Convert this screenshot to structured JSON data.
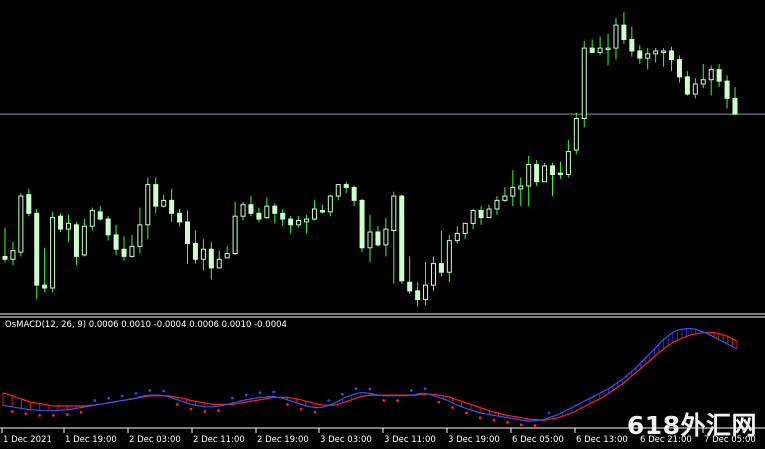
{
  "indicator": {
    "name": "OsMACD(12, 26, 9)",
    "values": [
      "0.0006",
      "0.0010",
      "-0.0004",
      "0.0006",
      "0.0010",
      "-0.0004"
    ]
  },
  "time_axis": {
    "labels": [
      "1 Dec 2021",
      "1 Dec 19:00",
      "2 Dec 03:00",
      "2 Dec 11:00",
      "2 Dec 19:00",
      "3 Dec 03:00",
      "3 Dec 11:00",
      "3 Dec 19:00",
      "6 Dec 05:00",
      "6 Dec 13:00",
      "6 Dec 21:00",
      "7 Dec 05:00"
    ]
  },
  "watermark": {
    "text": "618外汇网"
  },
  "colors": {
    "background": "#000000",
    "candle": "#ccffcc",
    "wick": "#33ff33",
    "separator": "#ffffff",
    "price_line": "#8a9aa8",
    "macd_line": "#3355ff",
    "signal_line": "#ff2222",
    "histogram_positive": "#3333ff",
    "histogram_negative": "#ff2222",
    "dots_positive": "#3344ff",
    "dots_negative": "#ff2222"
  },
  "chart_data": [
    {
      "type": "candlestick",
      "candles": [
        [
          30,
          28,
          50,
          26
        ],
        [
          28,
          34,
          40,
          24
        ],
        [
          33,
          72,
          74,
          30
        ],
        [
          73,
          60,
          77,
          58
        ],
        [
          60,
          10,
          63,
          0
        ],
        [
          10,
          8,
          36,
          5
        ],
        [
          8,
          57,
          61,
          5
        ],
        [
          58,
          49,
          60,
          47
        ],
        [
          49,
          53,
          59,
          40
        ],
        [
          52,
          30,
          54,
          24
        ],
        [
          31,
          51,
          56,
          30
        ],
        [
          51,
          62,
          64,
          48
        ],
        [
          61,
          56,
          65,
          55
        ],
        [
          56,
          45,
          58,
          41
        ],
        [
          45,
          35,
          52,
          31
        ],
        [
          35,
          30,
          44,
          27
        ],
        [
          30,
          37,
          45,
          29
        ],
        [
          37,
          52,
          64,
          32
        ],
        [
          52,
          80,
          85,
          42
        ],
        [
          80,
          65,
          85,
          60
        ],
        [
          65,
          69,
          73,
          64
        ],
        [
          69,
          60,
          77,
          54
        ],
        [
          60,
          54,
          63,
          51
        ],
        [
          54,
          39,
          62,
          25
        ],
        [
          39,
          28,
          48,
          25
        ],
        [
          28,
          35,
          42,
          20
        ],
        [
          35,
          22,
          40,
          14
        ],
        [
          22,
          28,
          34,
          22
        ],
        [
          29,
          32,
          37,
          29
        ],
        [
          32,
          58,
          68,
          31
        ],
        [
          58,
          66,
          68,
          55
        ],
        [
          66,
          60,
          72,
          58
        ],
        [
          60,
          56,
          64,
          54
        ],
        [
          57,
          65,
          71,
          56
        ],
        [
          65,
          60,
          67,
          53
        ],
        [
          60,
          56,
          63,
          51
        ],
        [
          56,
          52,
          58,
          46
        ],
        [
          52,
          55,
          58,
          50
        ],
        [
          54,
          56,
          59,
          46
        ],
        [
          56,
          63,
          69,
          55
        ],
        [
          62,
          61,
          66,
          60
        ],
        [
          61,
          72,
          73,
          58
        ],
        [
          72,
          80,
          80,
          69
        ],
        [
          80,
          78,
          82,
          74
        ],
        [
          78,
          69,
          79,
          65
        ],
        [
          69,
          36,
          70,
          33
        ],
        [
          36,
          47,
          59,
          26
        ],
        [
          47,
          38,
          51,
          37
        ],
        [
          38,
          49,
          57,
          30
        ],
        [
          48,
          72,
          75,
          11
        ],
        [
          72,
          13,
          73,
          11
        ],
        [
          12,
          6,
          30,
          4
        ],
        [
          6,
          0,
          12,
          -5
        ],
        [
          0,
          10,
          26,
          -4
        ],
        [
          10,
          25,
          30,
          6
        ],
        [
          25,
          19,
          48,
          16
        ],
        [
          19,
          41,
          45,
          12
        ],
        [
          41,
          46,
          51,
          39
        ],
        [
          46,
          53,
          53,
          42
        ],
        [
          53,
          62,
          63,
          49
        ],
        [
          62,
          57,
          65,
          52
        ],
        [
          57,
          63,
          66,
          57
        ],
        [
          63,
          69,
          72,
          59
        ],
        [
          69,
          72,
          78,
          68
        ],
        [
          72,
          78,
          90,
          65
        ],
        [
          77,
          79,
          85,
          65
        ],
        [
          79,
          94,
          100,
          65
        ],
        [
          94,
          82,
          97,
          79
        ],
        [
          82,
          93,
          95,
          84
        ],
        [
          93,
          87,
          95,
          72
        ],
        [
          88,
          87,
          96,
          84
        ],
        [
          87,
          103,
          111,
          85
        ],
        [
          104,
          126,
          130,
          101
        ],
        [
          126,
          175,
          180,
          120
        ],
        [
          175,
          172,
          181,
          172
        ],
        [
          172,
          175,
          183,
          170
        ],
        [
          175,
          175,
          185,
          163
        ],
        [
          175,
          191,
          196,
          167
        ],
        [
          191,
          181,
          200,
          178
        ],
        [
          181,
          173,
          190,
          169
        ],
        [
          173,
          168,
          177,
          164
        ],
        [
          168,
          171,
          175,
          160
        ],
        [
          171,
          173,
          175,
          165
        ],
        [
          173,
          173,
          175,
          162
        ],
        [
          173,
          167,
          176,
          159
        ],
        [
          167,
          155,
          170,
          151
        ],
        [
          155,
          143,
          159,
          142
        ],
        [
          143,
          150,
          154,
          140
        ],
        [
          150,
          153,
          164,
          147
        ],
        [
          153,
          160,
          163,
          142
        ],
        [
          160,
          152,
          164,
          148
        ],
        [
          152,
          140,
          156,
          133
        ],
        [
          140,
          129,
          148,
          129
        ]
      ],
      "horizontal_line": 129
    },
    {
      "type": "macd",
      "title": "OsMACD(12, 26, 9)",
      "macd": [
        0.12,
        0.11,
        0.1,
        0.09,
        0.08,
        0.07,
        0.06,
        0.06,
        0.05,
        0.05,
        0.05,
        0.05,
        0.05,
        0.06,
        0.06,
        0.07,
        0.08,
        0.09,
        0.1,
        0.11,
        0.12,
        0.13,
        0.14,
        0.15,
        0.16,
        0.17,
        0.18,
        0.19,
        0.2,
        0.21,
        0.23,
        0.24,
        0.25,
        0.25,
        0.25,
        0.24,
        0.23,
        0.21,
        0.19,
        0.17,
        0.15,
        0.13,
        0.12,
        0.11,
        0.1,
        0.1,
        0.1,
        0.11,
        0.12,
        0.13,
        0.15,
        0.16,
        0.18,
        0.19,
        0.2,
        0.21,
        0.22,
        0.22,
        0.23,
        0.23,
        0.22,
        0.21,
        0.19,
        0.17,
        0.15,
        0.13,
        0.11,
        0.1,
        0.09,
        0.09,
        0.1,
        0.12,
        0.14,
        0.17,
        0.2,
        0.23,
        0.25,
        0.27,
        0.28,
        0.28,
        0.27,
        0.26,
        0.25,
        0.24,
        0.24,
        0.24,
        0.24,
        0.24,
        0.24,
        0.25,
        0.26,
        0.27,
        0.27,
        0.26,
        0.24,
        0.22,
        0.2,
        0.18,
        0.15,
        0.12,
        0.1,
        0.08,
        0.06,
        0.04,
        0.02,
        0.01,
        0.0,
        -0.01,
        -0.02,
        -0.03,
        -0.04,
        -0.05,
        -0.06,
        -0.07,
        -0.08,
        -0.08,
        -0.08,
        -0.07,
        -0.06,
        -0.04,
        -0.02,
        0.0,
        0.03,
        0.06,
        0.09,
        0.12,
        0.15,
        0.18,
        0.21,
        0.24,
        0.27,
        0.3,
        0.33,
        0.37,
        0.41,
        0.45,
        0.5,
        0.55,
        0.6,
        0.66,
        0.72,
        0.78,
        0.84,
        0.9,
        0.96,
        1.01,
        1.05,
        1.08,
        1.09,
        1.1,
        1.1,
        1.09,
        1.07,
        1.05,
        1.02,
        0.99,
        0.96,
        0.93,
        0.9,
        0.87,
        0.84
      ],
      "signal": [
        0.28,
        0.26,
        0.24,
        0.22,
        0.2,
        0.18,
        0.16,
        0.15,
        0.14,
        0.13,
        0.12,
        0.11,
        0.11,
        0.11,
        0.11,
        0.11,
        0.11,
        0.11,
        0.11,
        0.12,
        0.12,
        0.13,
        0.14,
        0.15,
        0.16,
        0.17,
        0.18,
        0.19,
        0.2,
        0.21,
        0.22,
        0.23,
        0.24,
        0.24,
        0.24,
        0.24,
        0.24,
        0.23,
        0.22,
        0.21,
        0.2,
        0.18,
        0.17,
        0.16,
        0.15,
        0.14,
        0.13,
        0.13,
        0.13,
        0.13,
        0.13,
        0.14,
        0.15,
        0.16,
        0.17,
        0.18,
        0.19,
        0.2,
        0.21,
        0.22,
        0.22,
        0.22,
        0.22,
        0.21,
        0.2,
        0.19,
        0.17,
        0.16,
        0.14,
        0.13,
        0.12,
        0.12,
        0.12,
        0.13,
        0.15,
        0.17,
        0.19,
        0.21,
        0.23,
        0.24,
        0.25,
        0.25,
        0.25,
        0.25,
        0.25,
        0.25,
        0.25,
        0.25,
        0.25,
        0.25,
        0.25,
        0.26,
        0.26,
        0.26,
        0.26,
        0.25,
        0.24,
        0.23,
        0.21,
        0.19,
        0.17,
        0.15,
        0.13,
        0.11,
        0.09,
        0.07,
        0.05,
        0.03,
        0.02,
        0.0,
        -0.01,
        -0.02,
        -0.03,
        -0.04,
        -0.05,
        -0.06,
        -0.06,
        -0.07,
        -0.07,
        -0.06,
        -0.05,
        -0.04,
        -0.02,
        0.0,
        0.02,
        0.05,
        0.08,
        0.11,
        0.14,
        0.17,
        0.2,
        0.23,
        0.27,
        0.31,
        0.35,
        0.39,
        0.44,
        0.49,
        0.54,
        0.59,
        0.64,
        0.69,
        0.74,
        0.79,
        0.84,
        0.88,
        0.92,
        0.95,
        0.98,
        1.0,
        1.02,
        1.03,
        1.04,
        1.05,
        1.05,
        1.05,
        1.04,
        1.02,
        1.0,
        0.97,
        0.94
      ]
    }
  ]
}
